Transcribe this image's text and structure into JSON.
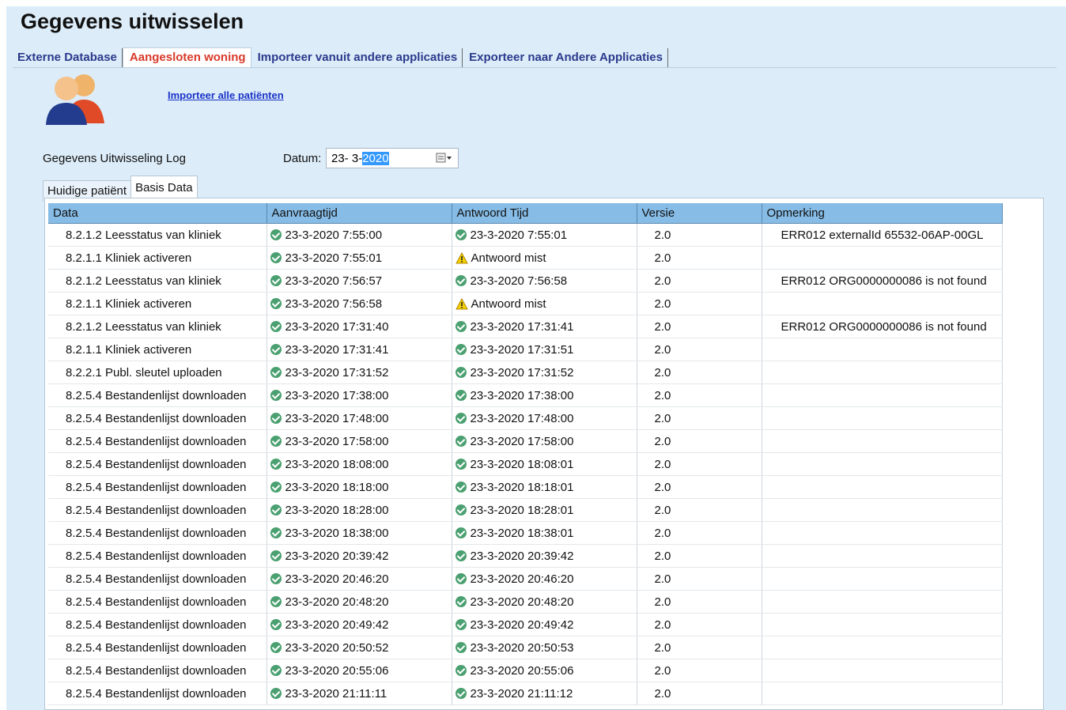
{
  "page_title": "Gegevens uitwisselen",
  "tabs": [
    {
      "label": "Externe Database"
    },
    {
      "label": "Aangesloten woning"
    },
    {
      "label": "Importeer vanuit andere applicaties"
    },
    {
      "label": "Exporteer naar Andere Applicaties"
    }
  ],
  "import_link": "Importeer alle patiënten",
  "log_label": "Gegevens Uitwisseling Log",
  "datum": {
    "label": "Datum:",
    "value_prefix": "23- 3-",
    "value_selected": "2020"
  },
  "subtabs": [
    {
      "label": "Huidige patiënt"
    },
    {
      "label": "Basis Data"
    }
  ],
  "grid": {
    "columns": [
      "Data",
      "Aanvraagtijd",
      "Antwoord Tijd",
      "Versie",
      "Opmerking"
    ],
    "rows": [
      {
        "data": "8.2.1.2 Leesstatus van kliniek",
        "req": "23-3-2020 7:55:00",
        "resp": "23-3-2020 7:55:01",
        "resp_status": "ok",
        "version": "2.0",
        "note": "ERR012 externalId 65532-06AP-00GL"
      },
      {
        "data": "8.2.1.1 Kliniek activeren",
        "req": "23-3-2020 7:55:01",
        "resp": "Antwoord mist",
        "resp_status": "warning",
        "version": "2.0",
        "note": ""
      },
      {
        "data": "8.2.1.2 Leesstatus van kliniek",
        "req": "23-3-2020 7:56:57",
        "resp": "23-3-2020 7:56:58",
        "resp_status": "ok",
        "version": "2.0",
        "note": "ERR012 ORG0000000086 is not found"
      },
      {
        "data": "8.2.1.1 Kliniek activeren",
        "req": "23-3-2020 7:56:58",
        "resp": "Antwoord mist",
        "resp_status": "warning",
        "version": "2.0",
        "note": ""
      },
      {
        "data": "8.2.1.2 Leesstatus van kliniek",
        "req": "23-3-2020 17:31:40",
        "resp": "23-3-2020 17:31:41",
        "resp_status": "ok",
        "version": "2.0",
        "note": "ERR012 ORG0000000086 is not found"
      },
      {
        "data": "8.2.1.1 Kliniek activeren",
        "req": "23-3-2020 17:31:41",
        "resp": "23-3-2020 17:31:51",
        "resp_status": "ok",
        "version": "2.0",
        "note": ""
      },
      {
        "data": "8.2.2.1 Publ. sleutel uploaden",
        "req": "23-3-2020 17:31:52",
        "resp": "23-3-2020 17:31:52",
        "resp_status": "ok",
        "version": "2.0",
        "note": ""
      },
      {
        "data": "8.2.5.4 Bestandenlijst downloaden",
        "req": "23-3-2020 17:38:00",
        "resp": "23-3-2020 17:38:00",
        "resp_status": "ok",
        "version": "2.0",
        "note": ""
      },
      {
        "data": "8.2.5.4 Bestandenlijst downloaden",
        "req": "23-3-2020 17:48:00",
        "resp": "23-3-2020 17:48:00",
        "resp_status": "ok",
        "version": "2.0",
        "note": ""
      },
      {
        "data": "8.2.5.4 Bestandenlijst downloaden",
        "req": "23-3-2020 17:58:00",
        "resp": "23-3-2020 17:58:00",
        "resp_status": "ok",
        "version": "2.0",
        "note": ""
      },
      {
        "data": "8.2.5.4 Bestandenlijst downloaden",
        "req": "23-3-2020 18:08:00",
        "resp": "23-3-2020 18:08:01",
        "resp_status": "ok",
        "version": "2.0",
        "note": ""
      },
      {
        "data": "8.2.5.4 Bestandenlijst downloaden",
        "req": "23-3-2020 18:18:00",
        "resp": "23-3-2020 18:18:01",
        "resp_status": "ok",
        "version": "2.0",
        "note": ""
      },
      {
        "data": "8.2.5.4 Bestandenlijst downloaden",
        "req": "23-3-2020 18:28:00",
        "resp": "23-3-2020 18:28:01",
        "resp_status": "ok",
        "version": "2.0",
        "note": ""
      },
      {
        "data": "8.2.5.4 Bestandenlijst downloaden",
        "req": "23-3-2020 18:38:00",
        "resp": "23-3-2020 18:38:01",
        "resp_status": "ok",
        "version": "2.0",
        "note": ""
      },
      {
        "data": "8.2.5.4 Bestandenlijst downloaden",
        "req": "23-3-2020 20:39:42",
        "resp": "23-3-2020 20:39:42",
        "resp_status": "ok",
        "version": "2.0",
        "note": ""
      },
      {
        "data": "8.2.5.4 Bestandenlijst downloaden",
        "req": "23-3-2020 20:46:20",
        "resp": "23-3-2020 20:46:20",
        "resp_status": "ok",
        "version": "2.0",
        "note": ""
      },
      {
        "data": "8.2.5.4 Bestandenlijst downloaden",
        "req": "23-3-2020 20:48:20",
        "resp": "23-3-2020 20:48:20",
        "resp_status": "ok",
        "version": "2.0",
        "note": ""
      },
      {
        "data": "8.2.5.4 Bestandenlijst downloaden",
        "req": "23-3-2020 20:49:42",
        "resp": "23-3-2020 20:49:42",
        "resp_status": "ok",
        "version": "2.0",
        "note": ""
      },
      {
        "data": "8.2.5.4 Bestandenlijst downloaden",
        "req": "23-3-2020 20:50:52",
        "resp": "23-3-2020 20:50:53",
        "resp_status": "ok",
        "version": "2.0",
        "note": ""
      },
      {
        "data": "8.2.5.4 Bestandenlijst downloaden",
        "req": "23-3-2020 20:55:06",
        "resp": "23-3-2020 20:55:06",
        "resp_status": "ok",
        "version": "2.0",
        "note": ""
      },
      {
        "data": "8.2.5.4 Bestandenlijst downloaden",
        "req": "23-3-2020 21:11:11",
        "resp": "23-3-2020 21:11:12",
        "resp_status": "ok",
        "version": "2.0",
        "note": ""
      }
    ]
  }
}
